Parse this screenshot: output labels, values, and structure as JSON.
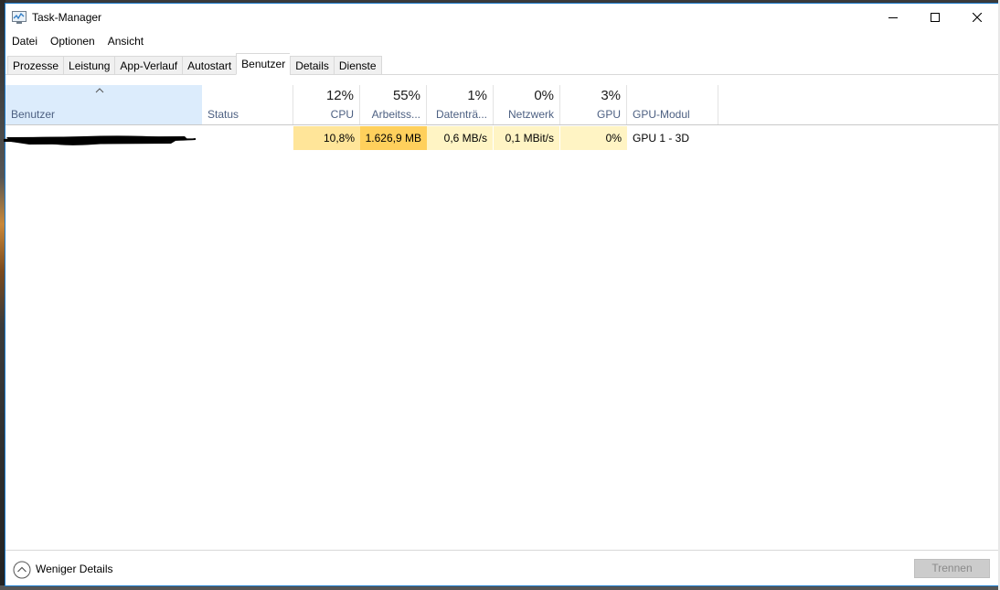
{
  "window": {
    "title": "Task-Manager"
  },
  "menu": [
    "Datei",
    "Optionen",
    "Ansicht"
  ],
  "tabs": [
    "Prozesse",
    "Leistung",
    "App-Verlauf",
    "Autostart",
    "Benutzer",
    "Details",
    "Dienste"
  ],
  "active_tab": "Benutzer",
  "columns": {
    "benutzer": {
      "label": "Benutzer"
    },
    "status": {
      "label": "Status"
    },
    "cpu": {
      "pct": "12%",
      "label": "CPU"
    },
    "arbeitsspeicher": {
      "pct": "55%",
      "label": "Arbeitss..."
    },
    "datentraeger": {
      "pct": "1%",
      "label": "Datenträ..."
    },
    "netzwerk": {
      "pct": "0%",
      "label": "Netzwerk"
    },
    "gpu": {
      "pct": "3%",
      "label": "GPU"
    },
    "gpu_modul": {
      "label": "GPU-Modul"
    }
  },
  "rows": [
    {
      "user": "",
      "status": "",
      "cpu": "10,8%",
      "arbeitsspeicher": "1.626,9 MB",
      "datentraeger": "0,6 MB/s",
      "netzwerk": "0,1 MBit/s",
      "gpu": "0%",
      "gpu_modul": "GPU 1 - 3D"
    }
  ],
  "colors": {
    "heat_light": "#fff4c4",
    "heat_medium": "#ffe599",
    "heat_strong": "#ffd05c",
    "header_selected": "#dcecfc",
    "border_accent": "#1979ca"
  },
  "footer": {
    "less_details_label": "Weniger Details",
    "disconnect_button": "Trennen"
  }
}
